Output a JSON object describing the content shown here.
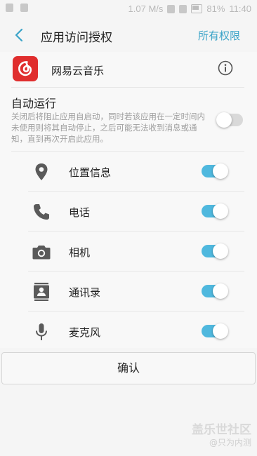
{
  "statusbar": {
    "speed": "1.07 M/s",
    "battery": "81%",
    "time": "11:40"
  },
  "header": {
    "title": "应用访问授权",
    "all_permissions": "所有权限"
  },
  "app": {
    "name": "网易云音乐"
  },
  "auto_run": {
    "title": "自动运行",
    "description": "关闭后将阻止应用自启动，同时若该应用在一定时间内未使用则将其自动停止，之后可能无法收到消息或通知，直到再次开启此应用。",
    "enabled": false
  },
  "permissions": [
    {
      "label": "位置信息",
      "icon": "location-pin-icon",
      "enabled": true
    },
    {
      "label": "电话",
      "icon": "phone-icon",
      "enabled": true
    },
    {
      "label": "相机",
      "icon": "camera-icon",
      "enabled": true
    },
    {
      "label": "通讯录",
      "icon": "contacts-icon",
      "enabled": true
    },
    {
      "label": "麦克风",
      "icon": "microphone-icon",
      "enabled": true
    }
  ],
  "confirm_label": "确认",
  "watermark": {
    "line1": "盖乐世社区",
    "line2": "@只为内测"
  },
  "colors": {
    "accent": "#4fb8de",
    "link": "#3aa3c8",
    "app_red": "#e02e2e",
    "icon_gray": "#5a5a5a"
  }
}
